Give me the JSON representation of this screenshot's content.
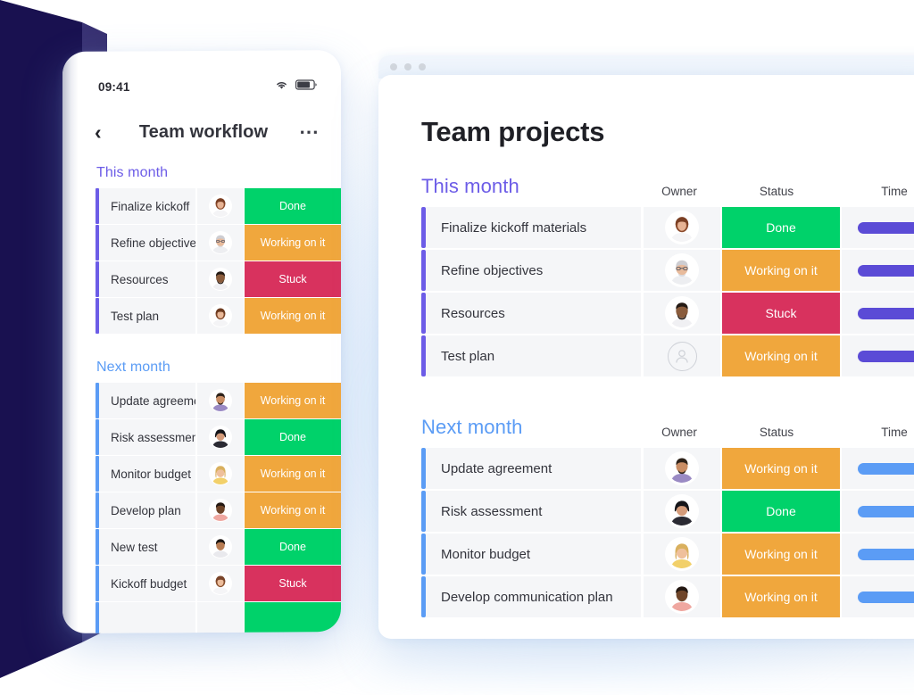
{
  "colors": {
    "accent_purple": "#6c5ce7",
    "accent_blue": "#5b9cf5",
    "status_done": "#00d26a",
    "status_working": "#f0a73d",
    "status_stuck": "#d8325e",
    "navy": "#191150",
    "page_background": "#ffffff"
  },
  "phone": {
    "status_bar": {
      "time": "09:41",
      "wifi_icon": "wifi-icon",
      "battery_icon": "battery-icon"
    },
    "nav": {
      "back_icon": "chevron-left-icon",
      "title": "Team workflow",
      "more_icon": "more-options-icon"
    },
    "sections": [
      {
        "title": "This month",
        "accent": "#6c5ce7",
        "rows": [
          {
            "name": "Finalize kickoff",
            "status": "Done",
            "status_color": "#00d26a",
            "avatar": "woman-red-hair"
          },
          {
            "name": "Refine objectives",
            "status": "Working on it",
            "status_color": "#f0a73d",
            "avatar": "man-glasses-grey"
          },
          {
            "name": "Resources",
            "status": "Stuck",
            "status_color": "#d8325e",
            "avatar": "man-beard-dark"
          },
          {
            "name": "Test plan",
            "status": "Working on it",
            "status_color": "#f0a73d",
            "avatar": "woman-brown-hair"
          }
        ]
      },
      {
        "title": "Next month",
        "accent": "#5b9cf5",
        "rows": [
          {
            "name": "Update agreement",
            "status": "Working on it",
            "status_color": "#f0a73d",
            "avatar": "man-purple-shirt"
          },
          {
            "name": "Risk assessment",
            "status": "Done",
            "status_color": "#00d26a",
            "avatar": "woman-black-hair"
          },
          {
            "name": "Monitor budget",
            "status": "Working on it",
            "status_color": "#f0a73d",
            "avatar": "woman-blonde"
          },
          {
            "name": "Develop plan",
            "status": "Working on it",
            "status_color": "#f0a73d",
            "avatar": "man-pink-shirt"
          },
          {
            "name": "New test",
            "status": "Done",
            "status_color": "#00d26a",
            "avatar": "man-short-hair"
          },
          {
            "name": "Kickoff budget",
            "status": "Stuck",
            "status_color": "#d8325e",
            "avatar": "woman-long-hair"
          }
        ]
      }
    ]
  },
  "desktop": {
    "window_dots": [
      "dot",
      "dot",
      "dot"
    ],
    "title": "Team projects",
    "sections": [
      {
        "title": "This month",
        "accent": "#6c5ce7",
        "columns": {
          "owner": "Owner",
          "status": "Status",
          "timeline": "Time"
        },
        "bar_color": "#5b4bd6",
        "rows": [
          {
            "name": "Finalize kickoff materials",
            "status": "Done",
            "status_color": "#00d26a",
            "avatar": "woman-red-hair"
          },
          {
            "name": "Refine objectives",
            "status": "Working on it",
            "status_color": "#f0a73d",
            "avatar": "man-glasses-grey"
          },
          {
            "name": "Resources",
            "status": "Stuck",
            "status_color": "#d8325e",
            "avatar": "man-beard-dark"
          },
          {
            "name": "Test plan",
            "status": "Working on it",
            "status_color": "#f0a73d",
            "avatar": "empty-person-placeholder"
          }
        ]
      },
      {
        "title": "Next month",
        "accent": "#5b9cf5",
        "columns": {
          "owner": "Owner",
          "status": "Status",
          "timeline": "Time"
        },
        "bar_color": "#5b9cf5",
        "rows": [
          {
            "name": "Update agreement",
            "status": "Working on it",
            "status_color": "#f0a73d",
            "avatar": "man-purple-shirt"
          },
          {
            "name": "Risk assessment",
            "status": "Done",
            "status_color": "#00d26a",
            "avatar": "woman-black-hair"
          },
          {
            "name": "Monitor budget",
            "status": "Working on it",
            "status_color": "#f0a73d",
            "avatar": "woman-blonde"
          },
          {
            "name": "Develop communication plan",
            "status": "Working on it",
            "status_color": "#f0a73d",
            "avatar": "man-pink-shirt"
          }
        ]
      }
    ]
  }
}
